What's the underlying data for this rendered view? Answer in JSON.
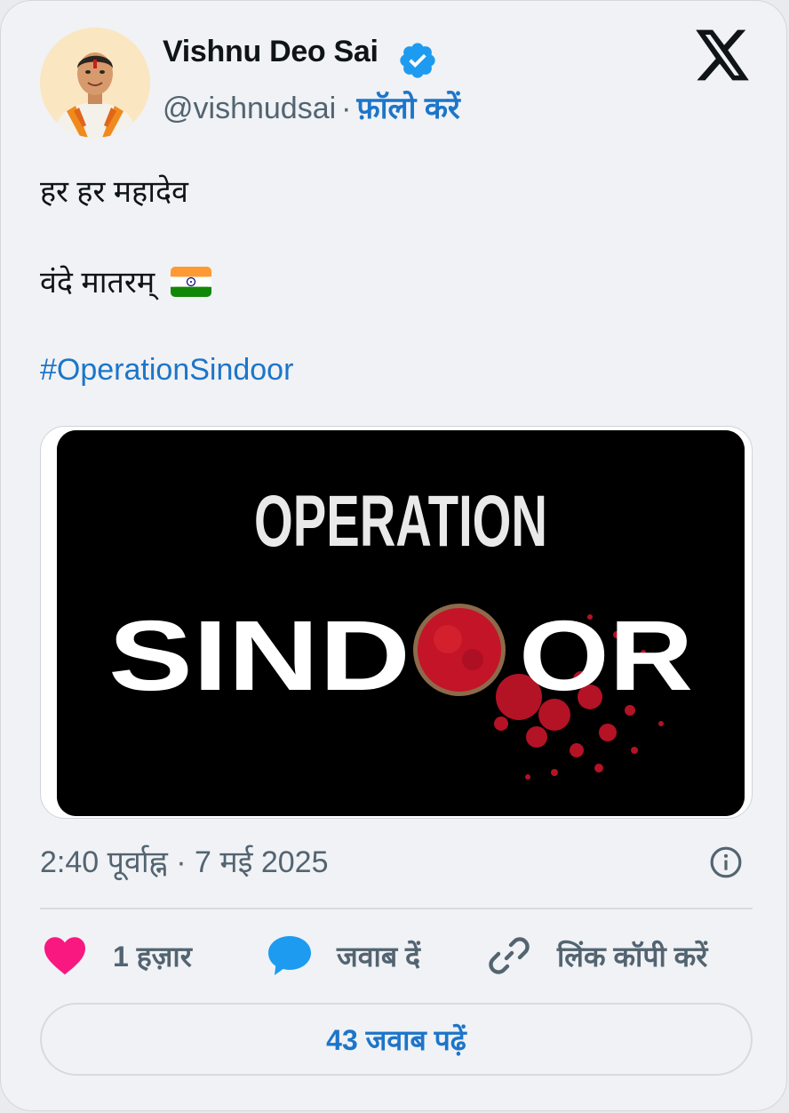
{
  "author": {
    "display_name": "Vishnu Deo Sai",
    "handle": "@vishnudsai",
    "separator": "·",
    "follow_label": "फ़ॉलो करें",
    "verified": true
  },
  "post": {
    "line1": "हर हर महादेव",
    "line2": "वंदे मातरम्",
    "hashtag": "#OperationSindoor",
    "image": {
      "title_top": "OPERATION",
      "title_bottom_left": "SIND",
      "title_bottom_right": "OR"
    }
  },
  "meta": {
    "time": "2:40 पूर्वाह्न",
    "separator": "·",
    "date": "7 मई 2025"
  },
  "actions": {
    "likes": "1 हज़ार",
    "reply": "जवाब दें",
    "copy_link": "लिंक कॉपी करें"
  },
  "read_replies": "43 जवाब पढ़ें",
  "colors": {
    "link": "#1d75c9",
    "verified": "#1d9bf0",
    "heart": "#f91880",
    "reply_bubble": "#1d9bf0",
    "text_primary": "#0f1419",
    "text_secondary": "#536471",
    "sindoor_red": "#d0182a"
  },
  "icons": [
    "verified-badge-icon",
    "x-logo-icon",
    "india-flag-emoji",
    "info-icon",
    "heart-icon",
    "reply-bubble-icon",
    "link-icon"
  ]
}
